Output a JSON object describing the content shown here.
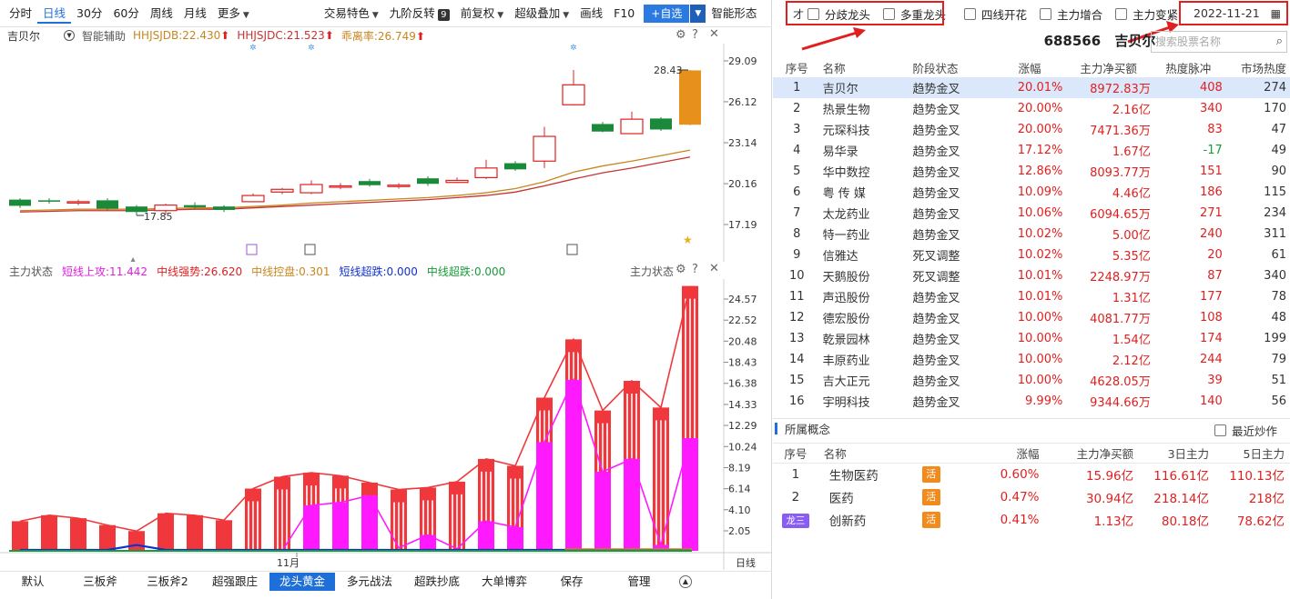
{
  "toolbar": {
    "items": [
      "分时",
      "日线",
      "30分",
      "60分",
      "周线",
      "月线",
      "更多"
    ],
    "active": "日线",
    "tools": [
      "交易特色",
      "九阶反转",
      "前复权",
      "超级叠加",
      "画线",
      "F10"
    ],
    "nine_badge": "9",
    "add_label": "+自选",
    "smart_label": "智能形态"
  },
  "kline": {
    "stock": "吉贝尔",
    "assist": "智能辅助",
    "ind1": "HHJSJDB:22.430",
    "ind2": "HHJSJDC:21.523",
    "ind3": "乖离率:26.749",
    "y_ticks": [
      "29.09",
      "26.12",
      "23.14",
      "20.16",
      "17.19"
    ],
    "high_label": "28.43",
    "low_label": "17.85",
    "colors": {
      "up": "#e02020",
      "down": "#1a8a3a",
      "orange": "#e8901c",
      "ma1": "#c8861e",
      "ma2": "#c83232"
    }
  },
  "sub": {
    "title": "主力状态",
    "title_right": "主力状态",
    "ind1": "短线上攻:11.442",
    "ind2": "中线强势:26.620",
    "ind3": "中线控盘:0.301",
    "ind4": "短线超跌:0.000",
    "ind5": "中线超跌:0.000",
    "y_ticks": [
      "24.57",
      "22.52",
      "20.48",
      "18.43",
      "16.38",
      "14.33",
      "12.29",
      "10.24",
      "8.19",
      "6.14",
      "4.10",
      "2.05"
    ],
    "month_label": "11月",
    "period_label": "日线"
  },
  "bottom_tabs": [
    "默认",
    "三板斧",
    "三板斧2",
    "超强跟庄",
    "龙头黄金",
    "多元战法",
    "超跌抄底",
    "大单博弈",
    "保存",
    "管理"
  ],
  "bottom_active": "龙头黄金",
  "filters": [
    "分歧龙头",
    "多重龙头",
    "四线开花",
    "主力增合",
    "主力变紧"
  ],
  "filter_prefix": "才",
  "date": "2022-11-21",
  "stock_code": "688566",
  "stock_name": "吉贝尔",
  "search_placeholder": "搜索股票名称",
  "rank_headers": [
    "序号",
    "名称",
    "阶段状态",
    "涨幅",
    "主力净买额",
    "热度脉冲",
    "市场热度"
  ],
  "rank_rows": [
    {
      "idx": "1",
      "name": "吉贝尔",
      "stage": "趋势金叉",
      "pct": "20.01%",
      "flow": "8972.83万",
      "heat": "408",
      "mkt": "274",
      "sel": true
    },
    {
      "idx": "2",
      "name": "热景生物",
      "stage": "趋势金叉",
      "pct": "20.00%",
      "flow": "2.16亿",
      "heat": "340",
      "mkt": "170"
    },
    {
      "idx": "3",
      "name": "元琛科技",
      "stage": "趋势金叉",
      "pct": "20.00%",
      "flow": "7471.36万",
      "heat": "83",
      "mkt": "47"
    },
    {
      "idx": "4",
      "name": "易华录",
      "stage": "趋势金叉",
      "pct": "17.12%",
      "flow": "1.67亿",
      "heat": "-17",
      "mkt": "49",
      "neg": true
    },
    {
      "idx": "5",
      "name": "华中数控",
      "stage": "趋势金叉",
      "pct": "12.86%",
      "flow": "8093.77万",
      "heat": "151",
      "mkt": "90"
    },
    {
      "idx": "6",
      "name": "粤 传 媒",
      "stage": "趋势金叉",
      "pct": "10.09%",
      "flow": "4.46亿",
      "heat": "186",
      "mkt": "115"
    },
    {
      "idx": "7",
      "name": "太龙药业",
      "stage": "趋势金叉",
      "pct": "10.06%",
      "flow": "6094.65万",
      "heat": "271",
      "mkt": "234"
    },
    {
      "idx": "8",
      "name": "特一药业",
      "stage": "趋势金叉",
      "pct": "10.02%",
      "flow": "5.00亿",
      "heat": "240",
      "mkt": "311"
    },
    {
      "idx": "9",
      "name": "信雅达",
      "stage": "死叉调整",
      "pct": "10.02%",
      "flow": "5.35亿",
      "heat": "20",
      "mkt": "61"
    },
    {
      "idx": "10",
      "name": "天鹅股份",
      "stage": "死叉调整",
      "pct": "10.01%",
      "flow": "2248.97万",
      "heat": "87",
      "mkt": "340"
    },
    {
      "idx": "11",
      "name": "声迅股份",
      "stage": "趋势金叉",
      "pct": "10.01%",
      "flow": "1.31亿",
      "heat": "177",
      "mkt": "78"
    },
    {
      "idx": "12",
      "name": "德宏股份",
      "stage": "趋势金叉",
      "pct": "10.00%",
      "flow": "4081.77万",
      "heat": "108",
      "mkt": "48"
    },
    {
      "idx": "13",
      "name": "乾景园林",
      "stage": "趋势金叉",
      "pct": "10.00%",
      "flow": "1.54亿",
      "heat": "174",
      "mkt": "199"
    },
    {
      "idx": "14",
      "name": "丰原药业",
      "stage": "趋势金叉",
      "pct": "10.00%",
      "flow": "2.12亿",
      "heat": "244",
      "mkt": "79"
    },
    {
      "idx": "15",
      "name": "吉大正元",
      "stage": "趋势金叉",
      "pct": "10.00%",
      "flow": "4628.05万",
      "heat": "39",
      "mkt": "51"
    },
    {
      "idx": "16",
      "name": "宇明科技",
      "stage": "趋势金叉",
      "pct": "9.99%",
      "flow": "9344.66万",
      "heat": "140",
      "mkt": "56"
    }
  ],
  "concept_title": "所属概念",
  "recent_label": "最近炒作",
  "concept_headers": [
    "序号",
    "名称",
    "涨幅",
    "主力净买额",
    "3日主力",
    "5日主力"
  ],
  "concept_rows": [
    {
      "idx": "1",
      "name": "生物医药",
      "tag": "活",
      "pct": "0.60%",
      "flow": "15.96亿",
      "d3": "116.61亿",
      "d5": "110.13亿"
    },
    {
      "idx": "2",
      "name": "医药",
      "tag": "活",
      "pct": "0.47%",
      "flow": "30.94亿",
      "d3": "218.14亿",
      "d5": "218亿"
    },
    {
      "idx": "龙三",
      "name": "创新药",
      "tag": "活",
      "pct": "0.41%",
      "flow": "1.13亿",
      "d3": "80.18亿",
      "d5": "78.62亿",
      "badge": true
    }
  ],
  "kline_candles": [
    {
      "o": 19.0,
      "c": 18.55,
      "h": 19.1,
      "l": 18.4
    },
    {
      "o": 18.95,
      "c": 18.85,
      "h": 19.1,
      "l": 18.7
    },
    {
      "o": 18.8,
      "c": 18.85,
      "h": 19.0,
      "l": 18.6
    },
    {
      "o": 18.95,
      "c": 18.35,
      "h": 19.1,
      "l": 18.2
    },
    {
      "o": 18.5,
      "c": 18.1,
      "h": 18.6,
      "l": 17.85
    },
    {
      "o": 18.2,
      "c": 18.6,
      "h": 18.7,
      "l": 17.9
    },
    {
      "o": 18.6,
      "c": 18.45,
      "h": 18.8,
      "l": 18.3
    },
    {
      "o": 18.5,
      "c": 18.25,
      "h": 18.6,
      "l": 18.1
    },
    {
      "o": 18.85,
      "c": 19.3,
      "h": 19.45,
      "l": 18.8
    },
    {
      "o": 19.55,
      "c": 19.75,
      "h": 19.85,
      "l": 19.4
    },
    {
      "o": 19.5,
      "c": 20.1,
      "h": 20.4,
      "l": 19.4
    },
    {
      "o": 19.9,
      "c": 20.0,
      "h": 20.2,
      "l": 19.75
    },
    {
      "o": 20.35,
      "c": 20.05,
      "h": 20.5,
      "l": 19.95
    },
    {
      "o": 20.05,
      "c": 20.05,
      "h": 20.2,
      "l": 19.8
    },
    {
      "o": 20.55,
      "c": 20.15,
      "h": 20.7,
      "l": 20.0
    },
    {
      "o": 20.25,
      "c": 20.4,
      "h": 20.6,
      "l": 20.2
    },
    {
      "o": 20.6,
      "c": 21.3,
      "h": 21.9,
      "l": 20.5
    },
    {
      "o": 21.65,
      "c": 21.2,
      "h": 21.8,
      "l": 21.1
    },
    {
      "o": 21.8,
      "c": 23.6,
      "h": 24.3,
      "l": 21.3
    },
    {
      "o": 25.9,
      "c": 27.35,
      "h": 28.43,
      "l": 25.85
    },
    {
      "o": 24.5,
      "c": 23.95,
      "h": 24.65,
      "l": 23.9
    },
    {
      "o": 23.8,
      "c": 24.85,
      "h": 25.4,
      "l": 23.85
    },
    {
      "o": 24.9,
      "c": 24.1,
      "h": 25.0,
      "l": 24.0
    },
    {
      "o": 24.45,
      "c": 28.4,
      "h": 28.43,
      "l": 24.4
    }
  ],
  "kline_ma1": [
    18.2,
    18.25,
    18.3,
    18.3,
    18.3,
    18.35,
    18.4,
    18.4,
    18.5,
    18.6,
    18.75,
    18.85,
    18.95,
    19.05,
    19.15,
    19.3,
    19.5,
    19.8,
    20.3,
    21.0,
    21.45,
    21.8,
    22.2,
    22.6
  ],
  "kline_ma2": [
    18.1,
    18.15,
    18.2,
    18.2,
    18.2,
    18.25,
    18.3,
    18.3,
    18.4,
    18.5,
    18.6,
    18.7,
    18.8,
    18.9,
    19.0,
    19.15,
    19.3,
    19.55,
    20.0,
    20.5,
    20.95,
    21.3,
    21.7,
    22.1
  ],
  "sub_bars": [
    3.0,
    3.6,
    3.3,
    2.6,
    2.0,
    3.8,
    3.6,
    3.1,
    6.3,
    7.5,
    7.9,
    7.6,
    6.9,
    6.2,
    6.4,
    7.0,
    9.3,
    8.6,
    15.5,
    21.4,
    14.2,
    17.2,
    14.5,
    26.8
  ],
  "sub_magenta": [
    0,
    0,
    0,
    0,
    0,
    0,
    0,
    0,
    0,
    0,
    4.6,
    4.9,
    5.6,
    0.3,
    1.6,
    0.2,
    3.0,
    2.4,
    11.0,
    17.3,
    8.0,
    9.3,
    0.6,
    11.4
  ],
  "sub_blue": [
    0,
    0,
    0,
    0,
    0.5,
    0,
    0,
    0,
    0,
    0,
    0,
    0,
    0,
    0,
    0,
    0,
    0,
    0,
    0,
    0,
    0,
    0,
    0,
    0
  ]
}
